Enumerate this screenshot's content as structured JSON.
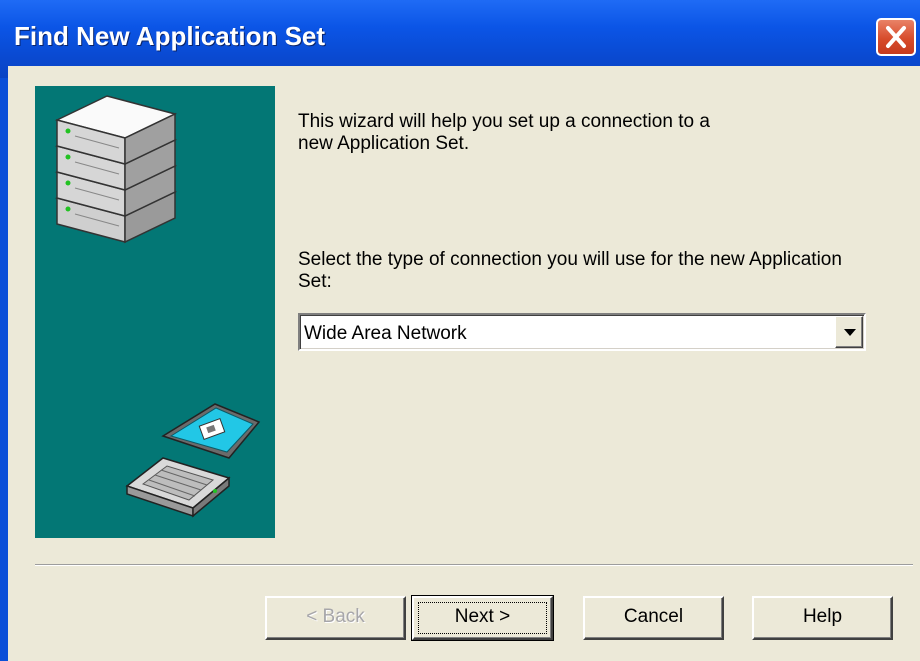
{
  "window": {
    "title": "Find New Application Set",
    "close_icon": "close-x-icon"
  },
  "illustration": {
    "server_icon": "server-stack-icon",
    "laptop_icon": "laptop-icon",
    "background_color": "#037775"
  },
  "content": {
    "intro_text": "This wizard will help you set up a connection to a\nnew Application Set.",
    "prompt_text": "Select the type of connection you will use for the new Application Set:",
    "connection_type": {
      "selected": "Wide Area Network"
    }
  },
  "buttons": {
    "back": "< Back",
    "next": "Next >",
    "cancel": "Cancel",
    "help": "Help"
  }
}
